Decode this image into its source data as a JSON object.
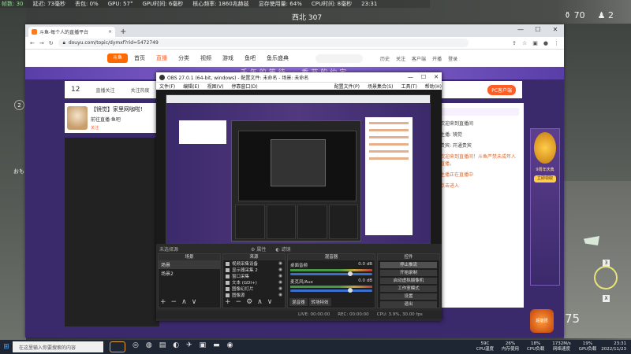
{
  "hud": {
    "stats": [
      "帧数: 30",
      "延迟: 73毫秒",
      "丢包: 0%",
      "GPU: 57°",
      "GPU时间: 6毫秒",
      "核心频率: 1860兆赫兹",
      "显存使用量: 64%",
      "CPU时间: 8毫秒",
      "23:31"
    ],
    "title": "西北 307",
    "score_a": "70",
    "score_b": "2",
    "left_badge": "2",
    "left_text": "おも",
    "ammo": "75",
    "key_3": "3",
    "key_x": "X"
  },
  "chrome": {
    "tab_title": "斗鱼-每个人的直播平台",
    "url": "douyu.com/topic/dymxf?rid=5472749",
    "win_controls": [
      "—",
      "☐",
      "✕"
    ]
  },
  "douyu": {
    "logo": "斗鱼",
    "nav": [
      "首页",
      "直播",
      "分类",
      "视频",
      "游戏",
      "鱼吧",
      "鱼乐盛典"
    ],
    "nav_icons": [
      "历史",
      "关注",
      "客户端",
      "开播",
      "登录"
    ],
    "banner": "千年的等待 · 季节的约定",
    "room_number": "12",
    "room_labels": [
      "直播关注",
      "关注热度",
      "分享"
    ],
    "pc_button": "PC客户端",
    "streamer_title": "【镜觉】家里网咖啦!",
    "streamer_sub": "前往直播·鱼吧",
    "streamer_tag": "关注",
    "chat_lines": [
      "欢迎来到直播间",
      "主播: 镜觉",
      "贵宾: 开通贵宾",
      "欢迎来到直播间！斗鱼严禁未成年人直播，",
      "主播正在直播中",
      "点击进入"
    ],
    "side_ad_text": "9周年庆典",
    "side_ad_btn": "立即领取",
    "gift_label": "超能团"
  },
  "obs": {
    "title": "OBS 27.0.1 (64-bit, windows) - 配置文件: 未命名 - 场景: 未命名",
    "menu": [
      "文件(F)",
      "编辑(E)",
      "视图(V)",
      "停靠窗口(D)",
      "配置文件(P)",
      "场景集合(S)",
      "工具(T)",
      "帮助(H)"
    ],
    "bar_left": "未选择源",
    "bar_props": "属性",
    "bar_filters": "滤镜",
    "dock_scenes": "场景",
    "dock_sources": "来源",
    "dock_mixer": "混音器",
    "dock_transitions": "转场特效",
    "dock_controls": "控件",
    "scenes": [
      "场景",
      "场景2"
    ],
    "sources": [
      "视频采集设备",
      "显示器采集 2",
      "窗口采集",
      "文本 (GDI+)",
      "图像幻灯片",
      "图像源"
    ],
    "mixer": [
      {
        "name": "桌面音频",
        "db": "0.0 dB"
      },
      {
        "name": "麦克风/Aux",
        "db": "0.0 dB"
      }
    ],
    "mixer_tabs": [
      "混音器",
      "转场特效"
    ],
    "controls": [
      "停止推流",
      "开始录制",
      "启动虚拟摄像机",
      "工作室模式",
      "设置",
      "退出"
    ],
    "status": [
      "LIVE: 00:00:00",
      "REC: 00:00:00",
      "CPU: 3.9%, 30.00 fps"
    ]
  },
  "taskbar": {
    "search_placeholder": "在这里输入你要搜索的内容",
    "stats": [
      {
        "value": "59C",
        "label": "CPU温度"
      },
      {
        "value": "26%",
        "label": "内存使用"
      },
      {
        "value": "18%",
        "label": "CPU负载"
      },
      {
        "value": "1732M/s",
        "label": "网络速度"
      },
      {
        "value": "19%",
        "label": "GPU负载"
      }
    ],
    "time": "23:31",
    "date": "2022/11/23"
  },
  "colors": {
    "douyu_orange": "#ff5d23",
    "douyu_purple": "#3b2a6b",
    "obs_dark": "#2b2b2b",
    "taskbar": "#1f2633"
  }
}
